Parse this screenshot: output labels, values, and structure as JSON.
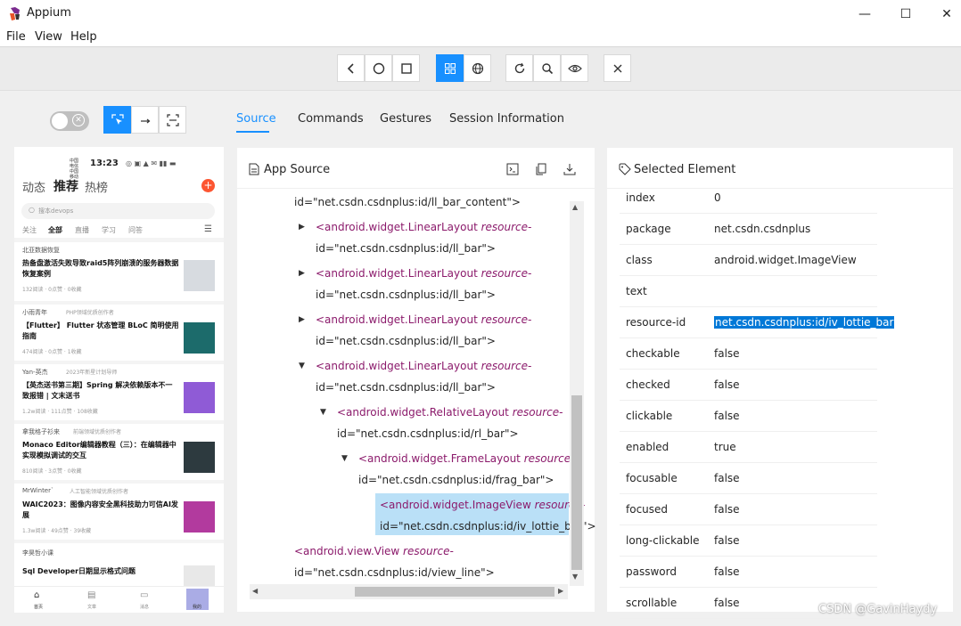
{
  "window": {
    "title": "Appium",
    "minimize": "—",
    "maximize": "☐",
    "close": "✕"
  },
  "menu": [
    "File",
    "View",
    "Help"
  ],
  "toolbar": {
    "back_icon": "chevron-left",
    "home_icon": "circle",
    "app_switch_icon": "square",
    "native_icon": "grid",
    "web_icon": "globe",
    "refresh_icon": "refresh",
    "search_icon": "search",
    "view_icon": "eye",
    "quit_icon": "close"
  },
  "modes": {
    "select_icon": "cursor-select",
    "swipe_icon": "arrow-right",
    "tap_icon": "frame"
  },
  "tabs": [
    "Source",
    "Commands",
    "Gestures",
    "Session Information"
  ],
  "source": {
    "title": "App Source",
    "lines": [
      {
        "indent": 0,
        "text": "id=\"net.csdn.csdnplus:id/ll_bar_content\">"
      },
      {
        "indent": 1,
        "tag": "<android.widget.LinearLayout",
        "attr": " resource-",
        "arrow": "right"
      },
      {
        "indent": 1,
        "text": "id=\"net.csdn.csdnplus:id/ll_bar\">"
      },
      {
        "indent": 1,
        "tag": "<android.widget.LinearLayout",
        "attr": " resource-",
        "arrow": "right"
      },
      {
        "indent": 1,
        "text": "id=\"net.csdn.csdnplus:id/ll_bar\">"
      },
      {
        "indent": 1,
        "tag": "<android.widget.LinearLayout",
        "attr": " resource-",
        "arrow": "right"
      },
      {
        "indent": 1,
        "text": "id=\"net.csdn.csdnplus:id/ll_bar\">"
      },
      {
        "indent": 1,
        "tag": "<android.widget.LinearLayout",
        "attr": " resource-",
        "arrow": "down"
      },
      {
        "indent": 1,
        "text": "id=\"net.csdn.csdnplus:id/ll_bar\">"
      },
      {
        "indent": 2,
        "tag": "<android.widget.RelativeLayout",
        "attr": " resource-",
        "arrow": "down"
      },
      {
        "indent": 2,
        "text": "id=\"net.csdn.csdnplus:id/rl_bar\">"
      },
      {
        "indent": 3,
        "tag": "<android.widget.FrameLayout",
        "attr": " resource-",
        "arrow": "down"
      },
      {
        "indent": 3,
        "text": "id=\"net.csdn.csdnplus:id/frag_bar\">"
      },
      {
        "indent": 4,
        "tag": "<android.widget.ImageView",
        "attr": " resource-",
        "selected": true
      },
      {
        "indent": 4,
        "text": "id=\"net.csdn.csdnplus:id/iv_lottie_bar\">",
        "selected": true
      },
      {
        "indent": 0,
        "tag": "<android.view.View",
        "attr": " resource-"
      },
      {
        "indent": 0,
        "text": "id=\"net.csdn.csdnplus:id/view_line\">"
      }
    ]
  },
  "selected": {
    "title": "Selected Element",
    "attributes": [
      {
        "name": "index",
        "value": "0"
      },
      {
        "name": "package",
        "value": "net.csdn.csdnplus"
      },
      {
        "name": "class",
        "value": "android.widget.ImageView"
      },
      {
        "name": "text",
        "value": ""
      },
      {
        "name": "resource-id",
        "value": "net.csdn.csdnplus:id/iv_lottie_bar"
      },
      {
        "name": "checkable",
        "value": "false"
      },
      {
        "name": "checked",
        "value": "false"
      },
      {
        "name": "clickable",
        "value": "false"
      },
      {
        "name": "enabled",
        "value": "true"
      },
      {
        "name": "focusable",
        "value": "false"
      },
      {
        "name": "focused",
        "value": "false"
      },
      {
        "name": "long-clickable",
        "value": "false"
      },
      {
        "name": "password",
        "value": "false"
      },
      {
        "name": "scrollable",
        "value": "false"
      }
    ]
  },
  "phone": {
    "time": "13:23",
    "carrier": "中国电信\n中国移动",
    "top_tabs": [
      "动态",
      "推荐",
      "热榜"
    ],
    "search_placeholder": "搜本devops",
    "sub_tabs": [
      "关注",
      "全部",
      "直播",
      "学习",
      "问答"
    ],
    "feed": [
      {
        "author": "北亚数据恢复",
        "title": "热备盘激活失败导致raid5阵列崩溃的服务器数据恢复案例",
        "meta": "132阅读 · 0点赞 · 0收藏"
      },
      {
        "author": "小雨青年",
        "badge": "PHP领域优质创作者",
        "title": "【Flutter】 Flutter 状态管理 BLoC 简明使用指南",
        "meta": "474阅读 · 0点赞 · 1收藏"
      },
      {
        "author": "Yan-英杰",
        "badge": "2023年新星计划导师",
        "title": "【英杰送书第三期】Spring 解决依赖版本不一致报错 | 文末送书",
        "meta": "1.2w阅读 · 111点赞 · 108收藏"
      },
      {
        "author": "拿我格子衫来",
        "badge": "前端领域优质创作者",
        "title": "Monaco Editor编辑器教程（三）：在编辑器中实现模拟调试的交互",
        "meta": "810阅读 · 3点赞 · 0收藏"
      },
      {
        "author": "MrWinter`",
        "badge": "人工智能领域优质创作者",
        "title": "WAIC2023：图像内容安全黑科技助力可信AI发展",
        "meta": "1.3w阅读 · 49点赞 · 39收藏"
      },
      {
        "author": "李昊哲小课",
        "title": "Sql Developer日期显示格式问题",
        "meta": ""
      }
    ],
    "bottom_nav": [
      "首页",
      "文章",
      "消息",
      "我的"
    ]
  },
  "watermark": "CSDN @GavinHaydy"
}
